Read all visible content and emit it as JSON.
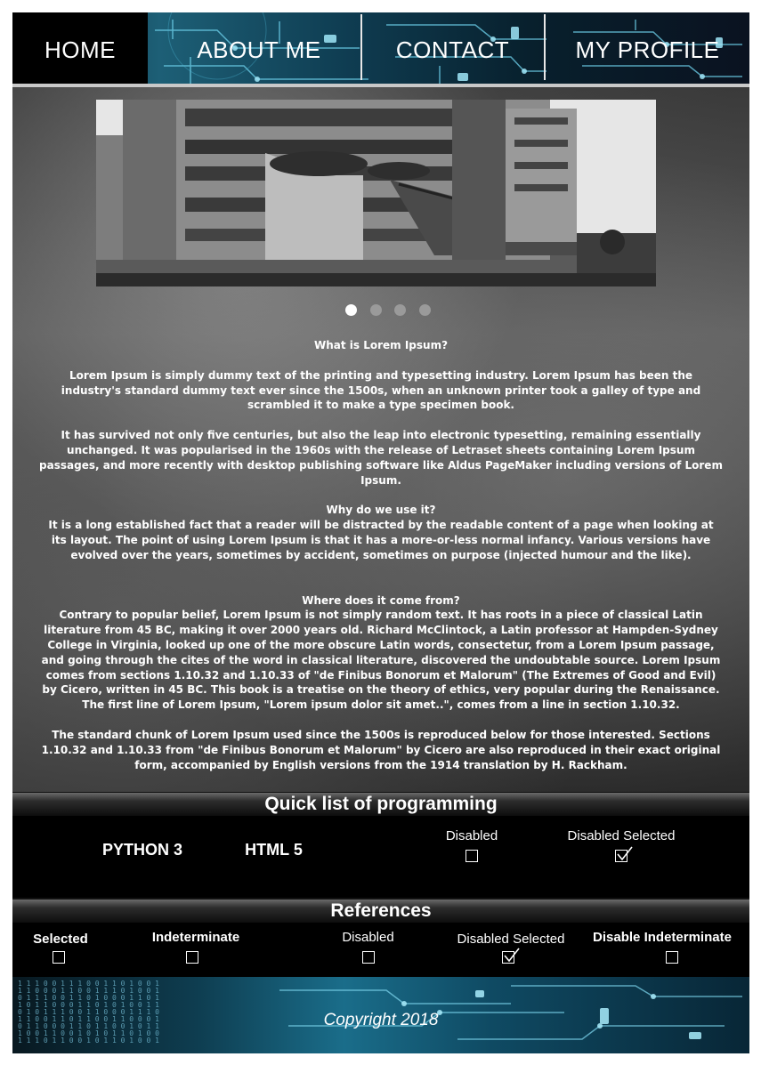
{
  "nav": {
    "items": [
      "HOME",
      "ABOUT ME",
      "CONTACT",
      "MY PROFILE"
    ],
    "active": "HOME"
  },
  "slider": {
    "image": "building-photo",
    "slides": 4,
    "current": 1
  },
  "article": {
    "p1_title": "What is Lorem Ipsum?",
    "p1": "Lorem Ipsum is simply dummy text of the printing and typesetting industry. Lorem Ipsum has been the industry's standard dummy text ever since the 1500s, when an unknown printer took a galley of type and scrambled it to make a type specimen book.",
    "p2": "It has survived not only five centuries, but also the leap into electronic typesetting, remaining essentially unchanged. It was popularised in the 1960s with the release of Letraset sheets containing Lorem Ipsum passages, and more recently with desktop publishing software like Aldus PageMaker including versions of Lorem Ipsum.",
    "p3_title": "Why do we use it?",
    "p3": "It is a long established fact that a reader will be distracted by the readable content of a page when looking at its layout. The point of using Lorem Ipsum is that it has a more-or-less normal infancy. Various versions have evolved over the years, sometimes by accident, sometimes on purpose (injected humour and the like).",
    "p4_title": "Where does it come from?",
    "p4": "Contrary to popular belief, Lorem Ipsum is not simply random text. It has roots in a piece of classical Latin literature from 45 BC, making it over 2000 years old. Richard McClintock, a Latin professor at Hampden-Sydney College in Virginia, looked up one of the more obscure Latin words, consectetur, from a Lorem Ipsum passage, and going through the cites of the word in classical literature, discovered the undoubtable source. Lorem Ipsum comes from sections 1.10.32 and 1.10.33 of \"de Finibus Bonorum et Malorum\" (The Extremes of Good and Evil) by Cicero, written in 45 BC. This book is a treatise on the theory of ethics, very popular during the Renaissance. The first line of Lorem Ipsum, \"Lorem ipsum dolor sit amet..\", comes from a line in section 1.10.32.",
    "p5": "The standard chunk of Lorem Ipsum used since the 1500s is reproduced below for those interested. Sections 1.10.32 and 1.10.33 from \"de Finibus Bonorum et Malorum\" by Cicero are also reproduced in their exact original form, accompanied by English versions from the 1914 translation by H. Rackham."
  },
  "programming": {
    "title": "Quick list of programming",
    "items": [
      "PYTHON 3",
      "HTML 5"
    ],
    "checkbox_disabled_label": "Disabled",
    "checkbox_disabled_selected_label": "Disabled Selected"
  },
  "references": {
    "title": "References",
    "checkboxes": [
      {
        "label": "Selected",
        "state": "unchecked"
      },
      {
        "label": "Indeterminate",
        "state": "unchecked"
      },
      {
        "label": "Disabled",
        "state": "unchecked"
      },
      {
        "label": "Disabled Selected",
        "state": "checked"
      },
      {
        "label": "Disable Indeterminate",
        "state": "unchecked"
      }
    ]
  },
  "footer": {
    "copyright": "Copyright 2018"
  },
  "colors": {
    "nav_accent": "#1d5f76",
    "active_bg": "#000000",
    "footer_accent": "#1a6d8a"
  }
}
